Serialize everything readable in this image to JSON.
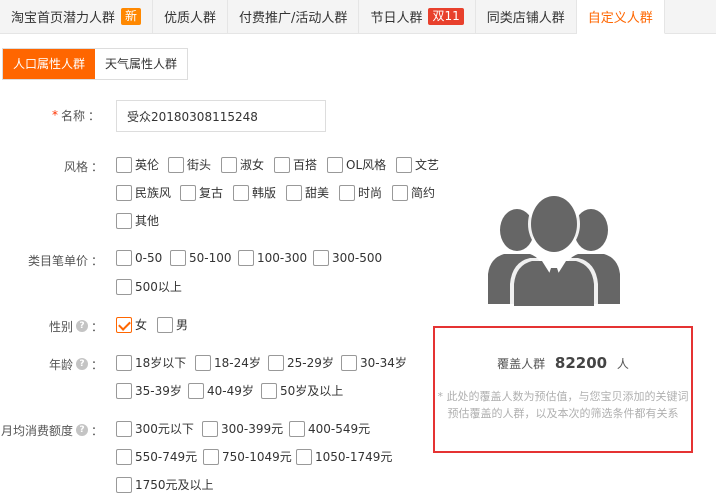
{
  "top_tabs": [
    {
      "label": "淘宝首页潜力人群",
      "badge": "新",
      "badge_color": "#ff8800"
    },
    {
      "label": "优质人群"
    },
    {
      "label": "付费推广/活动人群"
    },
    {
      "label": "节日人群",
      "badge": "双11",
      "badge_color": "#e8402c"
    },
    {
      "label": "同类店铺人群"
    },
    {
      "label": "自定义人群",
      "active": true
    }
  ],
  "sub_tabs": [
    {
      "label": "人口属性人群",
      "active": true
    },
    {
      "label": "天气属性人群"
    }
  ],
  "form": {
    "name": {
      "required_mark": "*",
      "label": "名称",
      "colon": "：",
      "value": "受众20180308115248"
    },
    "style": {
      "label": "风格",
      "colon": "：",
      "options": [
        "英伦",
        "街头",
        "淑女",
        "百搭",
        "OL风格",
        "文艺",
        "民族风",
        "复古",
        "韩版",
        "甜美",
        "时尚",
        "简约",
        "其他"
      ]
    },
    "price": {
      "label": "类目笔单价",
      "colon": "：",
      "options": [
        "0-50",
        "50-100",
        "100-300",
        "300-500",
        "500以上"
      ]
    },
    "gender": {
      "label": "性别",
      "help": "?",
      "colon": "：",
      "options": [
        {
          "label": "女",
          "checked": true
        },
        {
          "label": "男",
          "checked": false
        }
      ]
    },
    "age": {
      "label": "年龄",
      "help": "?",
      "colon": "：",
      "options": [
        "18岁以下",
        "18-24岁",
        "25-29岁",
        "30-34岁",
        "35-39岁",
        "40-49岁",
        "50岁及以上"
      ]
    },
    "spend": {
      "label": "月均消费额度",
      "help": "?",
      "colon": "：",
      "options": [
        "300元以下",
        "300-399元",
        "400-549元",
        "550-749元",
        "750-1049元",
        "1050-1749元",
        "1750元及以上"
      ]
    }
  },
  "coverage": {
    "prefix": "覆盖人群",
    "count": "82200",
    "suffix": "人",
    "note": "* 此处的覆盖人数为预估值，与您宝贝添加的关键词预估覆盖的人群，以及本次的筛选条件都有关系",
    "icon": "audience-group-icon"
  },
  "colors": {
    "accent": "#ff6600",
    "highlight_border": "#e53333"
  }
}
